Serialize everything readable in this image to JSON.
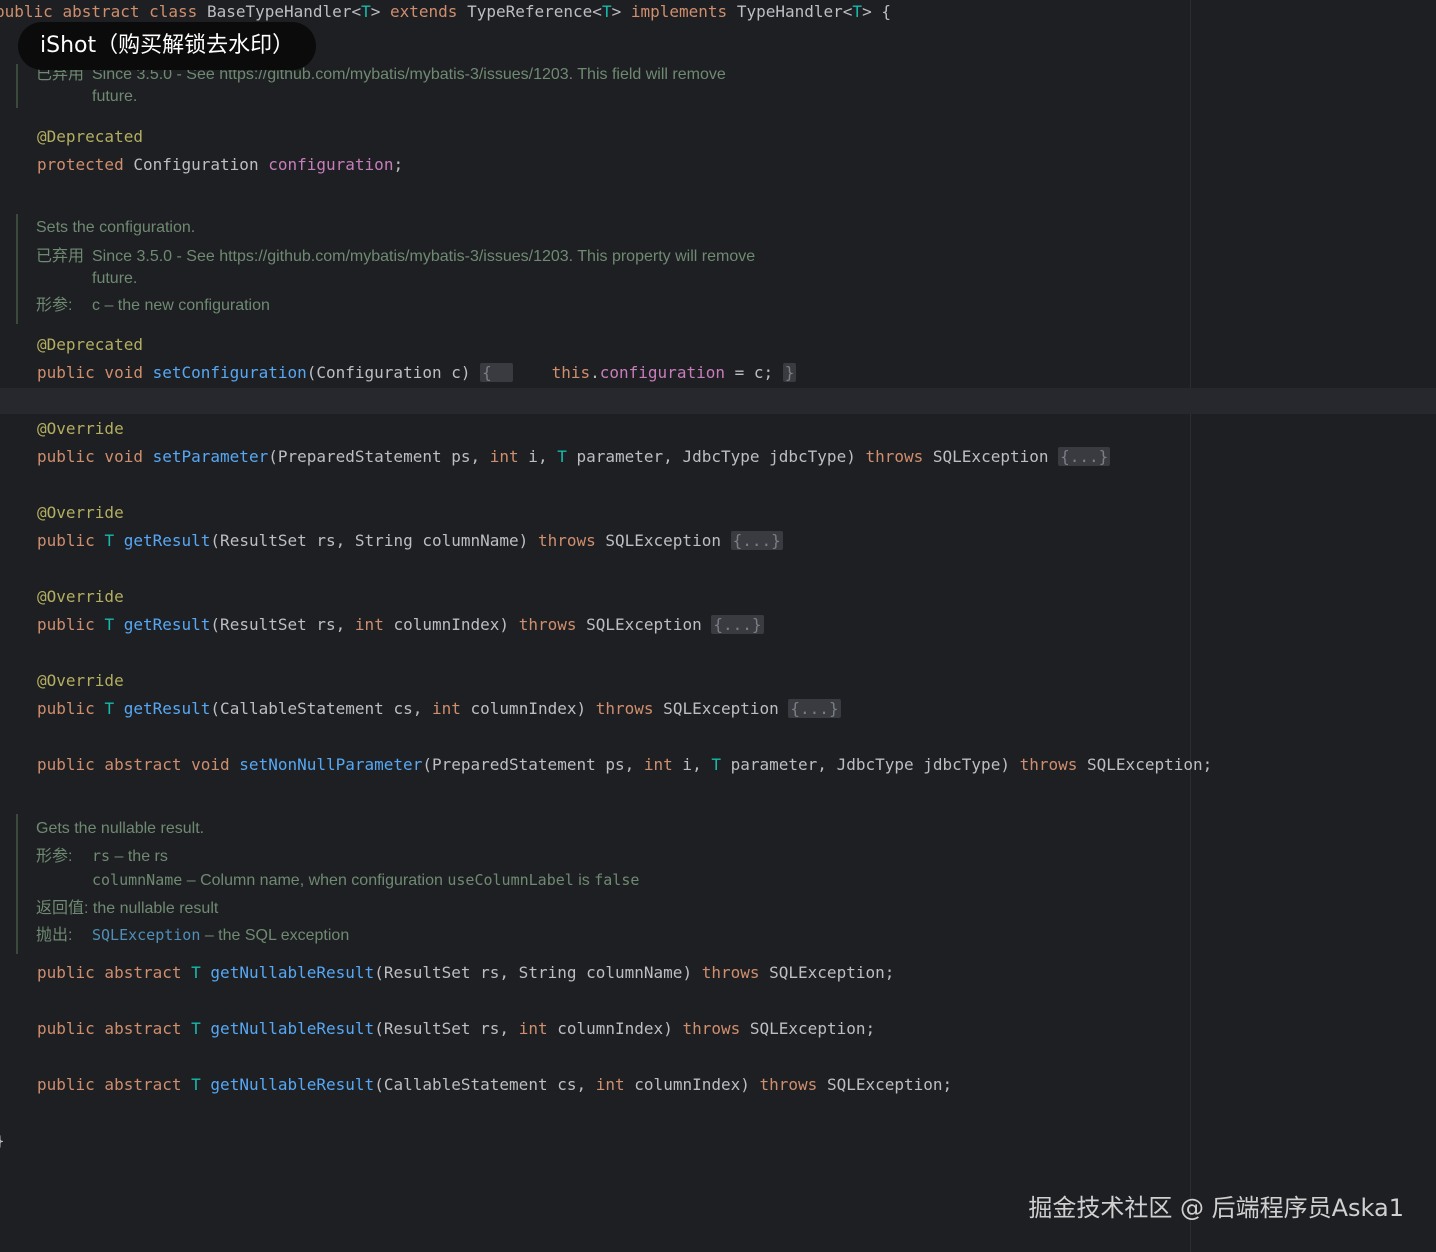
{
  "class_decl": {
    "public": "public",
    "abstract": "abstract",
    "class": "class",
    "name": "BaseTypeHandler<",
    "tparam": "T",
    "close": ">",
    "extends": "extends",
    "super": "TypeReference<",
    "implements": "implements",
    "iface": "TypeHandler<",
    "brace": "> {"
  },
  "overlay": {
    "text": "iShot（购买解锁去水印）"
  },
  "doc1": {
    "tag": "已弃用",
    "text1": "Since 3.5.0 - See https://github.com/mybatis/mybatis-3/issues/1203. This field will remove",
    "text2": "future."
  },
  "field": {
    "annotation": "@Deprecated",
    "modifier": "protected",
    "type": "Configuration",
    "name": "configuration",
    "semi": ";"
  },
  "doc2": {
    "summary": "Sets the configuration.",
    "tag": "已弃用",
    "text1": "Since 3.5.0 - See https://github.com/mybatis/mybatis-3/issues/1203. This property will remove",
    "text2": "future.",
    "param_label": "形参:",
    "param_text": "c – the new configuration"
  },
  "setter": {
    "annotation": "@Deprecated",
    "mods": "public void",
    "name": "setConfiguration",
    "params": "(Configuration c)",
    "open": "{",
    "this": "this",
    "dot": ".",
    "field": "configuration",
    "assign": " = c;",
    "close": "}"
  },
  "methods": [
    {
      "annotation": "@Override",
      "mods": "public void",
      "name": "setParameter",
      "p1": "(PreparedStatement ps, ",
      "p1kw": "int",
      "p2": " i, ",
      "p2t": "T",
      "p3": " parameter, JdbcType jdbcType) ",
      "throws": "throws",
      "exc": " SQLException ",
      "fold": "{...}"
    },
    {
      "annotation": "@Override",
      "mods": "public",
      "rtype": "T",
      "name": "getResult",
      "p1": "(ResultSet rs, String columnName) ",
      "throws": "throws",
      "exc": " SQLException ",
      "fold": "{...}"
    },
    {
      "annotation": "@Override",
      "mods": "public",
      "rtype": "T",
      "name": "getResult",
      "p1": "(ResultSet rs, ",
      "p1kw": "int",
      "p2": " columnIndex) ",
      "throws": "throws",
      "exc": " SQLException ",
      "fold": "{...}"
    },
    {
      "annotation": "@Override",
      "mods": "public",
      "rtype": "T",
      "name": "getResult",
      "p1": "(CallableStatement cs, ",
      "p1kw": "int",
      "p2": " columnIndex) ",
      "throws": "throws",
      "exc": " SQLException ",
      "fold": "{...}"
    }
  ],
  "abstract_set": {
    "mods": "public abstract void",
    "name": "setNonNullParameter",
    "p1": "(PreparedStatement ps, ",
    "p1kw": "int",
    "p2": " i, ",
    "p2t": "T",
    "p3": " parameter, JdbcType jdbcType) ",
    "throws": "throws",
    "exc": " SQLException;"
  },
  "doc3": {
    "summary": "Gets the nullable result.",
    "param_label": "形参:",
    "param1_name": "rs",
    "param1_text": " – the rs",
    "param2_name": "columnName",
    "param2_text": " – Column name, when configuration ",
    "param2_code": "useColumnLabel",
    "param2_text2": " is ",
    "param2_code2": "false",
    "return_label": "返回值:",
    "return_text": "the nullable result",
    "throws_label": "抛出:",
    "throws_link": "SQLException",
    "throws_text": " – the SQL exception"
  },
  "abstract_get": [
    {
      "mods": "public abstract",
      "rtype": "T",
      "name": "getNullableResult",
      "p1": "(ResultSet rs, String columnName) ",
      "throws": "throws",
      "exc": " SQLException;"
    },
    {
      "mods": "public abstract",
      "rtype": "T",
      "name": "getNullableResult",
      "p1": "(ResultSet rs, ",
      "p1kw": "int",
      "p2": " columnIndex) ",
      "throws": "throws",
      "exc": " SQLException;"
    },
    {
      "mods": "public abstract",
      "rtype": "T",
      "name": "getNullableResult",
      "p1": "(CallableStatement cs, ",
      "p1kw": "int",
      "p2": " columnIndex) ",
      "throws": "throws",
      "exc": " SQLException;"
    }
  ],
  "closing": {
    "brace": "}"
  },
  "watermark": {
    "text": "掘金技术社区 @ 后端程序员Aska1"
  },
  "colors": {
    "background": "#1e1f22",
    "keyword": "#cf8e6d",
    "annotation": "#b3ae60",
    "method": "#56a8f5",
    "field": "#c77dbb",
    "type_param": "#16baac",
    "doc": "#6f8a72"
  }
}
